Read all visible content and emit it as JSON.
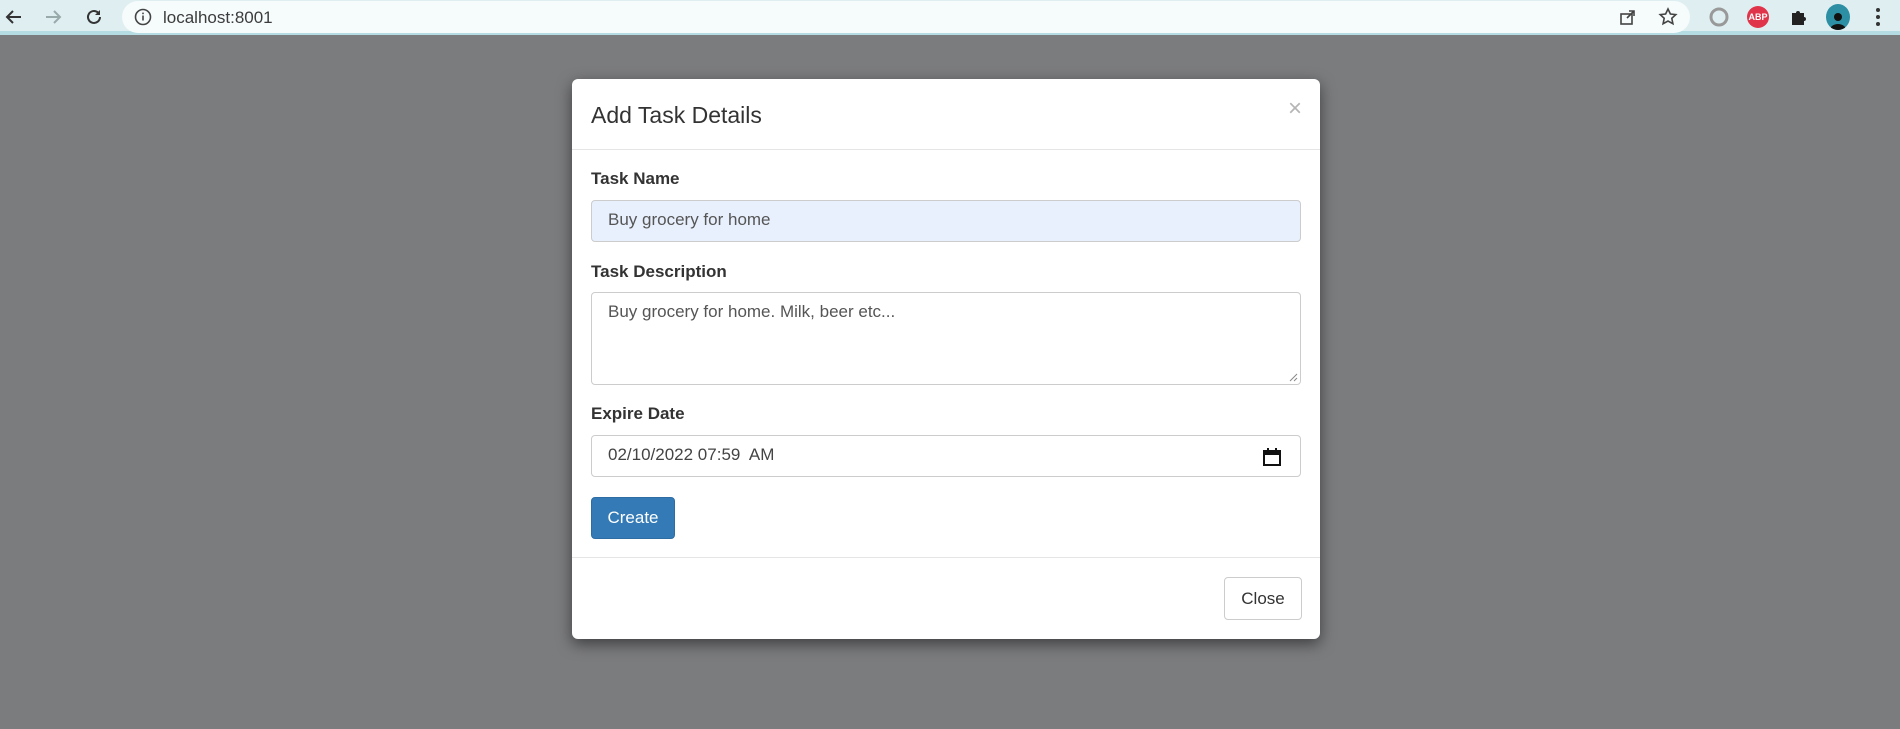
{
  "browser": {
    "url": "localhost:8001",
    "extensions": {
      "abp_label": "ABP"
    }
  },
  "modal": {
    "title": "Add Task Details",
    "close_symbol": "×",
    "task_name": {
      "label": "Task Name",
      "value": "Buy grocery for home"
    },
    "task_description": {
      "label": "Task Description",
      "value": "Buy grocery for home. Milk, beer etc..."
    },
    "expire_date": {
      "label": "Expire Date",
      "value": "02/10/2022 07:59  AM"
    },
    "create_label": "Create",
    "close_label": "Close"
  },
  "colors": {
    "primary": "#337ab7",
    "backdrop": "#7b7c7e",
    "toolbar": "#dfeff1",
    "abp": "#e0344a"
  }
}
